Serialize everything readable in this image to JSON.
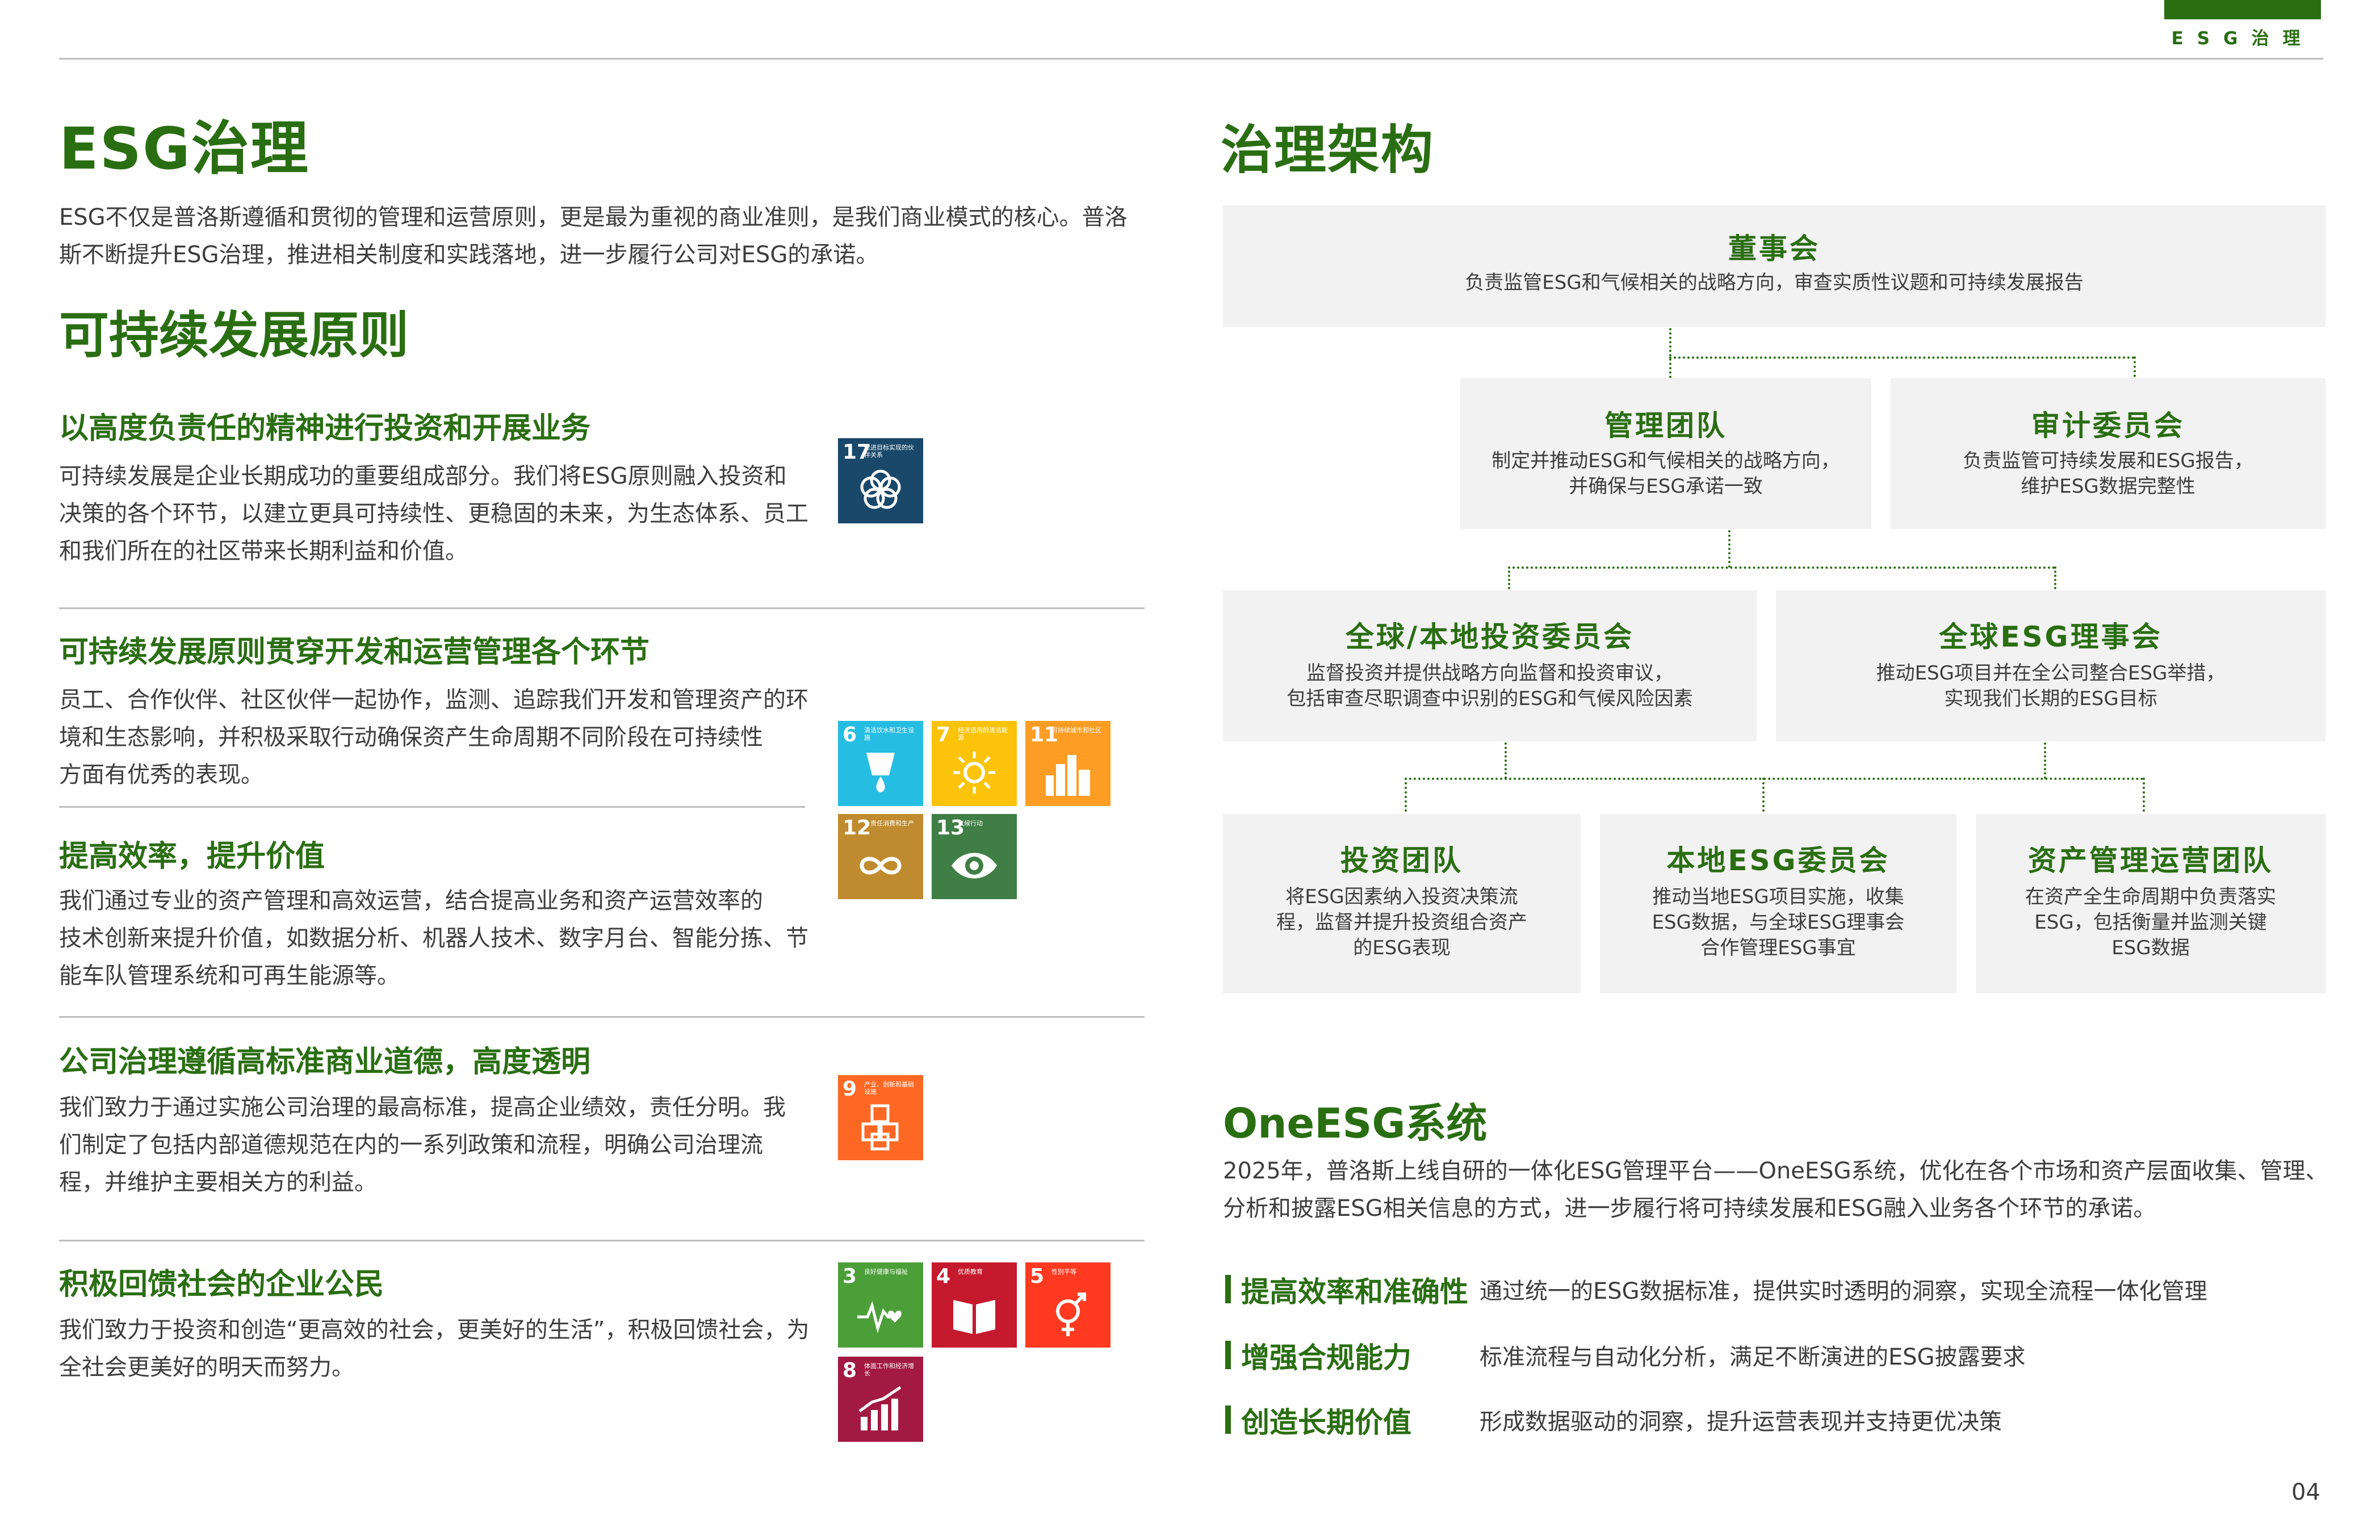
{
  "header": {
    "section_tab": "ESG治理"
  },
  "left": {
    "title": "ESG治理",
    "intro": [
      "ESG不仅是普洛斯遵循和贯彻的管理和运营原则，更是最为重视的商业准则，是我们商业模式的核心。普洛",
      "斯不断提升ESG治理，推进相关制度和实践落地，进一步履行公司对ESG的承诺。"
    ],
    "principles_title": "可持续发展原则",
    "sections": [
      {
        "heading": "以高度负责任的精神进行投资和开展业务",
        "lines": [
          "可持续发展是企业长期成功的重要组成部分。我们将ESG原则融入投资和",
          "决策的各个环节，以建立更具可持续性、更稳固的未来，为生态体系、员工",
          "和我们所在的社区带来长期利益和价值。"
        ]
      },
      {
        "heading": "可持续发展原则贯穿开发和运营管理各个环节",
        "lines": [
          "员工、合作伙伴、社区伙伴一起协作，监测、追踪我们开发和管理资产的环",
          "境和生态影响，并积极采取行动确保资产生命周期不同阶段在可持续性",
          "方面有优秀的表现。"
        ]
      },
      {
        "heading": "提高效率，提升价值",
        "lines": [
          "我们通过专业的资产管理和高效运营，结合提高业务和资产运营效率的",
          "技术创新来提升价值，如数据分析、机器人技术、数字月台、智能分拣、节",
          "能车队管理系统和可再生能源等。"
        ]
      },
      {
        "heading": "公司治理遵循高标准商业道德，高度透明",
        "lines": [
          "我们致力于通过实施公司治理的最高标准，提高企业绩效，责任分明。我",
          "们制定了包括内部道德规范在内的一系列政策和流程，明确公司治理流",
          "程，并维护主要相关方的利益。"
        ]
      },
      {
        "heading": "积极回馈社会的企业公民",
        "lines": [
          "我们致力于投资和创造“更高效的社会，更美好的生活”，积极回馈社会，为",
          "全社会更美好的明天而努力。"
        ]
      }
    ]
  },
  "sdg_icons": [
    {
      "num": "17",
      "label": "促进目标实现的伙伴关系",
      "color": "#19486a",
      "icon": "partnership-flower-icon"
    },
    {
      "num": "6",
      "label": "清洁饮水和卫生设施",
      "color": "#26bde2",
      "icon": "water-drop-icon"
    },
    {
      "num": "7",
      "label": "经济适用的清洁能源",
      "color": "#fcc30b",
      "icon": "sun-icon"
    },
    {
      "num": "11",
      "label": "可持续城市和社区",
      "color": "#fd9d24",
      "icon": "city-icon"
    },
    {
      "num": "12",
      "label": "负责任消费和生产",
      "color": "#bf8b2e",
      "icon": "infinity-icon"
    },
    {
      "num": "13",
      "label": "气候行动",
      "color": "#3f7e44",
      "icon": "eye-globe-icon"
    },
    {
      "num": "9",
      "label": "产业、创新和基础设施",
      "color": "#fd6925",
      "icon": "cubes-icon"
    },
    {
      "num": "3",
      "label": "良好健康与福祉",
      "color": "#4c9f38",
      "icon": "heartbeat-icon"
    },
    {
      "num": "4",
      "label": "优质教育",
      "color": "#c5192d",
      "icon": "book-icon"
    },
    {
      "num": "5",
      "label": "性别平等",
      "color": "#ff3a21",
      "icon": "gender-icon"
    },
    {
      "num": "8",
      "label": "体面工作和经济增长",
      "color": "#a21942",
      "icon": "growth-chart-icon"
    }
  ],
  "governance": {
    "title": "治理架构",
    "board": {
      "name": "董事会",
      "desc": [
        "负责监管ESG和气候相关的战略方向，审查实质性议题和可持续发展报告"
      ]
    },
    "mgmt": {
      "name": "管理团队",
      "desc": [
        "制定并推动ESG和气候相关的战略方向，",
        "并确保与ESG承诺一致"
      ]
    },
    "audit": {
      "name": "审计委员会",
      "desc": [
        "负责监管可持续发展和ESG报告，",
        "维护ESG数据完整性"
      ]
    },
    "invest_committee": {
      "name": "全球/本地投资委员会",
      "desc": [
        "监督投资并提供战略方向监督和投资审议，",
        "包括审查尽职调查中识别的ESG和气候风险因素"
      ]
    },
    "esg_council": {
      "name": "全球ESG理事会",
      "desc": [
        "推动ESG项目并在全公司整合ESG举措，",
        "实现我们长期的ESG目标"
      ]
    },
    "invest_team": {
      "name": "投资团队",
      "desc": [
        "将ESG因素纳入投资决策流",
        "程，监督并提升投资组合资产",
        "的ESG表现"
      ]
    },
    "local_esg": {
      "name": "本地ESG委员会",
      "desc": [
        "推动当地ESG项目实施，收集",
        "ESG数据，与全球ESG理事会",
        "合作管理ESG事宜"
      ]
    },
    "asset_team": {
      "name": "资产管理运营团队",
      "desc": [
        "在资产全生命周期中负责落实",
        "ESG，包括衡量并监测关键",
        "ESG数据"
      ]
    }
  },
  "oneesg": {
    "title": "OneESG系统",
    "intro": [
      "2025年，普洛斯上线自研的一体化ESG管理平台——OneESG系统，优化在各个市场和资产层面收集、管理、",
      "分析和披露ESG相关信息的方式，进一步履行将可持续发展和ESG融入业务各个环节的承诺。"
    ],
    "features": [
      {
        "title": "提高效率和准确性",
        "desc": "通过统一的ESG数据标准，提供实时透明的洞察，实现全流程一体化管理"
      },
      {
        "title": "增强合规能力",
        "desc": "标准流程与自动化分析，满足不断演进的ESG披露要求"
      },
      {
        "title": "创造长期价值",
        "desc": "形成数据驱动的洞察，提升运营表现并支持更优决策"
      }
    ]
  },
  "page_number": "04"
}
